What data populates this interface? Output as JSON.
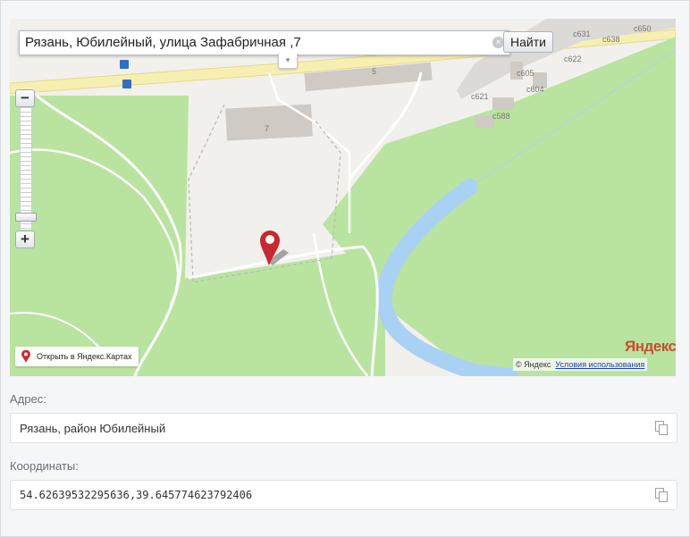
{
  "search": {
    "value": "Рязань, Юбилейный, улица Зафабричная ,7",
    "button_label": "Найти",
    "clear_symbol": "×",
    "toggle_symbol": "▾"
  },
  "map": {
    "zoom_in_symbol": "+",
    "zoom_out_symbol": "−",
    "open_link_label": "Открыть в Яндекс.Картах",
    "logo_text": "Яндекс",
    "copyright": "© Яндекс",
    "terms_label": "Условия использования",
    "building_labels": [
      "5",
      "7",
      "с631",
      "с638",
      "с650",
      "с622",
      "с605",
      "с604",
      "с621",
      "с588"
    ],
    "colors": {
      "park": "#b8e4a0",
      "water": "#a9d1f3",
      "marker": "#c8282f"
    }
  },
  "address": {
    "label": "Адрес:",
    "value": "Рязань, район Юбилейный"
  },
  "coordinates": {
    "label": "Координаты:",
    "value": "54.62639532295636,39.645774623792406"
  },
  "icons": {
    "copy": "copy-icon",
    "pin": "map-pin-icon",
    "marker": "location-marker-icon"
  }
}
